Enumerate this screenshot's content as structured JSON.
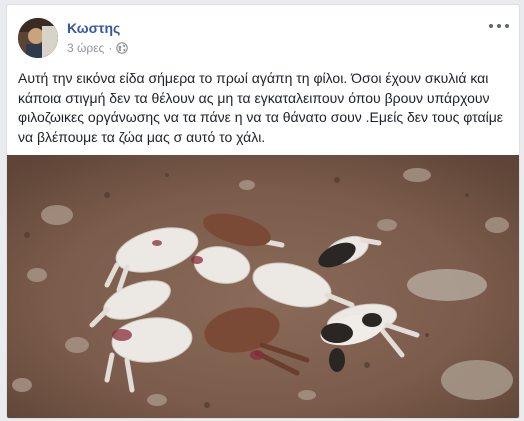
{
  "post": {
    "author_name": "Κωστης",
    "timestamp": "3 ώρες",
    "separator": "·",
    "privacy_icon": "globe-icon",
    "more_icon": "more-options-icon",
    "body_text": "Αυτή την εικόνα είδα σήμερα το πρωί αγάπη τη φίλοι. Όσοι έχουν σκυλιά και κάποια στιγμή δεν τα θέλουν ας μη τα εγκαταλειπουν όπου βρουν υπάρχουν φιλοζωικες οργάνωσης να τα πάνε η να τα θάνατο σουν .Εμείς δεν τους φταίμε να βλέπουμε τα ζώα μας σ αυτό το χάλι.",
    "image_subject": "photo-of-dead-lambs-and-goats-on-dirt"
  },
  "colors": {
    "page_bg": "#e9ebee",
    "card_bg": "#ffffff",
    "author_link": "#365899",
    "meta_text": "#90949c",
    "body_text": "#1d2129"
  }
}
